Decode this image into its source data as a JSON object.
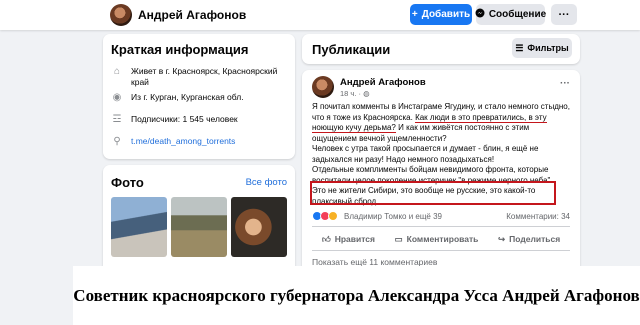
{
  "profile": {
    "name": "Андрей Агафонов",
    "add_label": "Добавить",
    "message_label": "Сообщение",
    "more_label": "···"
  },
  "info": {
    "title": "Краткая информация",
    "lives": "Живет в г. Красноярск, Красноярский край",
    "from": "Из г. Курган, Курганская обл.",
    "followers": "Подписчики: 1 545 человек",
    "link": "t.me/death_among_torrents"
  },
  "photos": {
    "title": "Фото",
    "all_label": "Все фото"
  },
  "publications": {
    "title": "Публикации",
    "filters_label": "Фильтры"
  },
  "post": {
    "author": "Андрей Агафонов",
    "time": "18 ч. ·",
    "dots": "···",
    "line1": "Я почитал комменты в Инстаграме Ягудину, и стало немного стыдно, что я тоже из Красноярска. ",
    "underline1": "Как люди в это превратились, в эту ноющую кучу дерьма?",
    "line1_after": " И как им живётся постоянно с этим ощущением вечной ущемленности?",
    "line2": "Человек с утра такой просыпается и думает - блин, я ещё не задыхался ни разу! Надо немного позадыхаться!",
    "line3": "Отдельные комплименты бойцам невидимого фронта, которые воспитали целое поколение истеричек \"в режиме черного неба\".",
    "highlight": "Это не жители Сибири, это вообще не русские, это какой-то плаксивый сброд.",
    "reactors": "Владимир Томко и ещё 39",
    "comments": "Комментарии: 34",
    "like_label": "Нравится",
    "comment_label": "Комментировать",
    "share_label": "Поделиться",
    "more_comments": "Показать ещё 11 комментариев"
  },
  "caption": "Советник красноярского губернатора Александра Усса Андрей Агафонов",
  "colors": {
    "accent": "#1877f2",
    "highlight_red": "#c4161c",
    "background": "#f0f2f5"
  }
}
